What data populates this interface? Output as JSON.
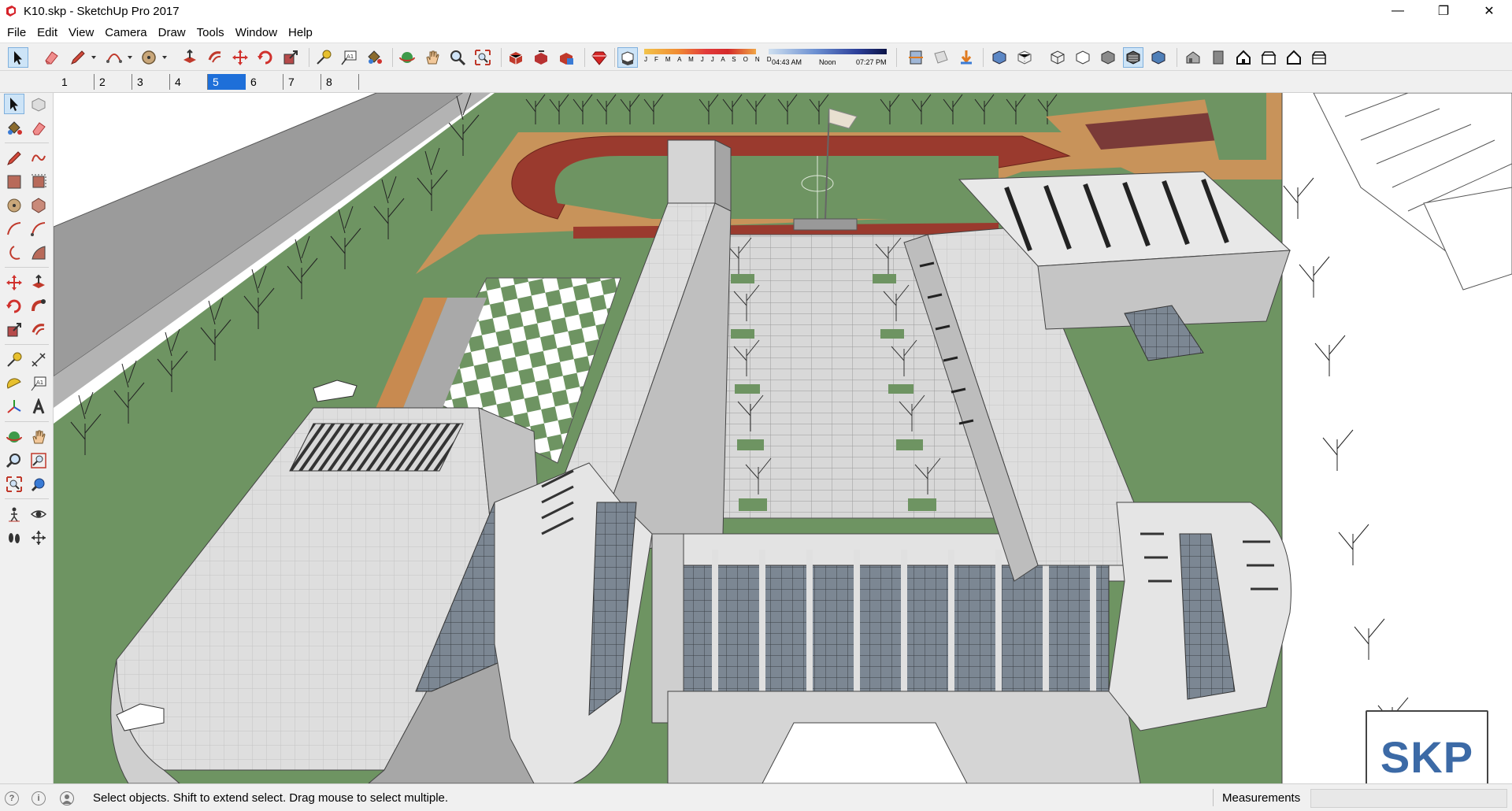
{
  "window": {
    "title": "K10.skp - SketchUp Pro 2017",
    "minimize": "—",
    "maximize": "❐",
    "close": "✕"
  },
  "menu": [
    "File",
    "Edit",
    "View",
    "Camera",
    "Draw",
    "Tools",
    "Window",
    "Help"
  ],
  "shadow": {
    "months": "J F M A M J J A S O N D",
    "time_start": "04:43 AM",
    "time_mid": "Noon",
    "time_end": "07:27 PM"
  },
  "scenes": {
    "tabs": [
      "1",
      "2",
      "3",
      "4",
      "5",
      "6",
      "7",
      "8"
    ],
    "active": "5"
  },
  "status": {
    "message": "Select objects. Shift to extend select. Drag mouse to select multiple.",
    "measurements_label": "Measurements",
    "measurements_value": ""
  },
  "badge": {
    "text": "SKP"
  },
  "colors": {
    "grass": "#6e9462",
    "track": "#9a3a2e",
    "sand": "#c8935a",
    "building": "#e3e3e3",
    "selection": "#1e6fd9",
    "brand": "#3c6aa6"
  }
}
